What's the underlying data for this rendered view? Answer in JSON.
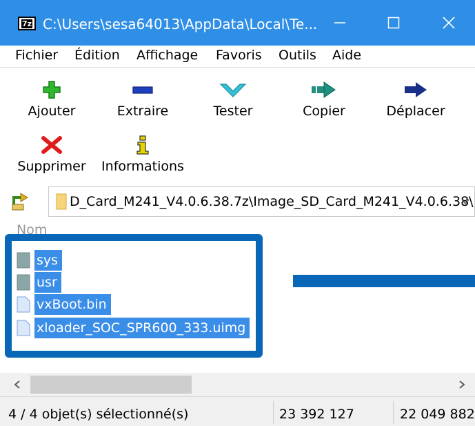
{
  "window": {
    "app_icon_text": "7z",
    "title": "C:\\Users\\sesa64013\\AppData\\Local\\Te...",
    "minimize_icon": "minimize-icon",
    "maximize_icon": "maximize-icon",
    "close_icon": "close-icon"
  },
  "menu": [
    "Fichier",
    "Édition",
    "Affichage",
    "Favoris",
    "Outils",
    "Aide"
  ],
  "toolbar": [
    {
      "label": "Ajouter",
      "icon": "plus-icon",
      "color": "#2fb82f"
    },
    {
      "label": "Extraire",
      "icon": "minus-icon",
      "color": "#1f3fbf"
    },
    {
      "label": "Tester",
      "icon": "check-icon",
      "color": "#33c3d8"
    },
    {
      "label": "Copier",
      "icon": "copy-arrow-icon",
      "color": "#1f8f7f"
    },
    {
      "label": "Déplacer",
      "icon": "move-arrow-icon",
      "color": "#1a2f8a"
    },
    {
      "label": "Supprimer",
      "icon": "delete-x-icon",
      "color": "#e01b1b"
    },
    {
      "label": "Informations",
      "icon": "info-icon",
      "color": "#e5d400"
    }
  ],
  "address": {
    "path": "D_Card_M241_V4.0.6.38.7z\\Image_SD_Card_M241_V4.0.6.38\\"
  },
  "list": {
    "column_header": "Nom",
    "items": [
      {
        "name": "sys",
        "type": "folder"
      },
      {
        "name": "usr",
        "type": "folder"
      },
      {
        "name": "vxBoot.bin",
        "type": "file"
      },
      {
        "name": "xloader_SOC_SPR600_333.uimg",
        "type": "file"
      }
    ]
  },
  "status": {
    "selection": "4 / 4 objet(s) sélectionné(s)",
    "size": "23 392 127",
    "packed": "22 049 882"
  },
  "colors": {
    "titlebar": "#2f8fe6",
    "selection": "#3b8ee8",
    "annotation": "#0a67b8"
  }
}
